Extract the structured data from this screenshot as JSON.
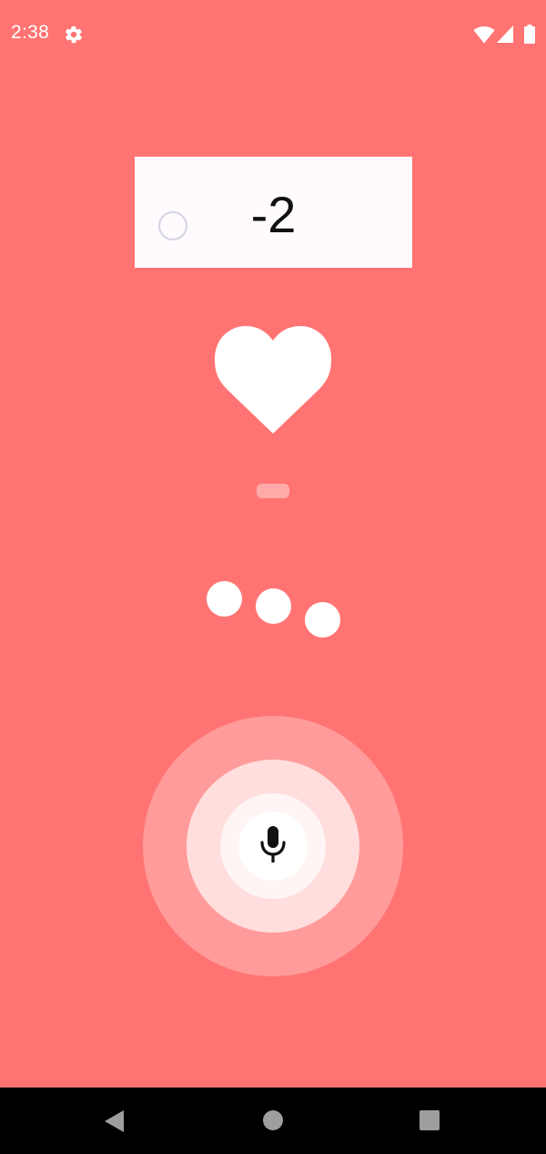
{
  "status_bar": {
    "time": "2:38",
    "icons": [
      "gear-icon",
      "wifi-icon",
      "cell-signal-icon",
      "battery-icon"
    ]
  },
  "counter": {
    "value": "-2"
  },
  "mic": {
    "icon": "microphone-icon"
  },
  "nav_bar": {
    "icons": [
      "back-icon",
      "home-icon",
      "recents-icon"
    ]
  },
  "colors": {
    "background": "#ff7473",
    "card": "#fefafe",
    "ring_outer": "#ff9c9b",
    "ring_middle": "#ffdedd",
    "ring_inner": "#fff5f4",
    "pill": "#ffaaa9",
    "nav_bar": "#000000"
  }
}
